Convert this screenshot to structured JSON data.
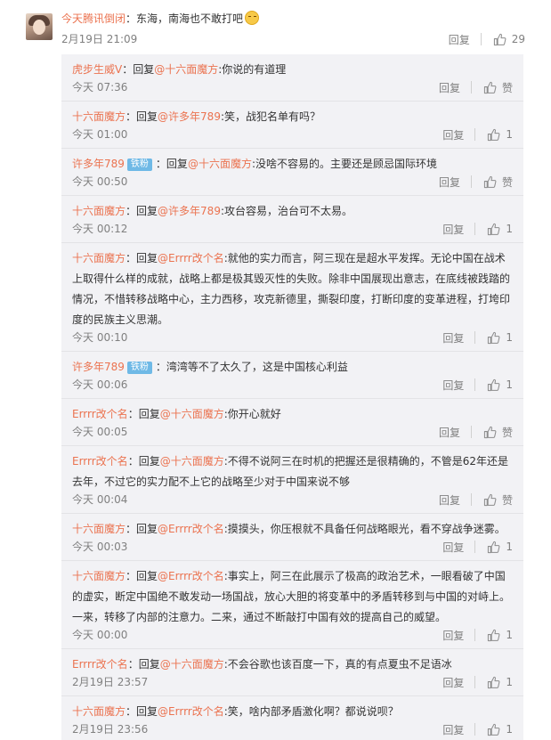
{
  "top_comment": {
    "username": "今天腾讯倒闭",
    "text": "：东海，南海也不敢打吧",
    "time": "2月19日 21:09",
    "reply_label": "回复",
    "like_count": "29",
    "emoji_icon": "thinking-face-icon"
  },
  "replies": [
    {
      "author": "虎步生威V",
      "badge": "",
      "mention": "@十六面魔方",
      "content": ":你说的有道理",
      "time": "今天 07:36",
      "reply_label": "回复",
      "likes": "赞"
    },
    {
      "author": "十六面魔方",
      "badge": "",
      "mention": "@许多年789",
      "content": ":笑，战犯名单有吗？",
      "time": "今天 01:00",
      "reply_label": "回复",
      "likes": "1"
    },
    {
      "author": "许多年789",
      "badge": "铁粉",
      "mention": "@十六面魔方",
      "content": ":没啥不容易的。主要还是顾忌国际环境",
      "time": "今天 00:50",
      "reply_label": "回复",
      "likes": "赞"
    },
    {
      "author": "十六面魔方",
      "badge": "",
      "mention": "@许多年789",
      "content": ":攻台容易，治台可不太易。",
      "time": "今天 00:12",
      "reply_label": "回复",
      "likes": "1"
    },
    {
      "author": "十六面魔方",
      "badge": "",
      "mention": "@Errrr改个名",
      "content": ":就他的实力而言，阿三现在是超水平发挥。无论中国在战术上取得什么样的成就，战略上都是极其毁灭性的失败。除非中国展现出意志，在底线被践踏的情况，不惜转移战略中心，主力西移，攻克新德里，撕裂印度，打断印度的变革进程，打垮印度的民族主义思潮。",
      "time": "今天 00:10",
      "reply_label": "回复",
      "likes": "1"
    },
    {
      "author": "许多年789",
      "badge": "铁粉",
      "mention": "",
      "content": "：湾湾等不了太久了，这是中国核心利益",
      "time": "今天 00:06",
      "reply_label": "回复",
      "likes": "1"
    },
    {
      "author": "Errrr改个名",
      "badge": "",
      "mention": "@十六面魔方",
      "content": ":你开心就好",
      "time": "今天 00:05",
      "reply_label": "回复",
      "likes": "赞"
    },
    {
      "author": "Errrr改个名",
      "badge": "",
      "mention": "@十六面魔方",
      "content": ":不得不说阿三在时机的把握还是很精确的，不管是62年还是去年，不过它的实力配不上它的战略至少对于中国来说不够",
      "time": "今天 00:04",
      "reply_label": "回复",
      "likes": "赞"
    },
    {
      "author": "十六面魔方",
      "badge": "",
      "mention": "@Errrr改个名",
      "content": ":摸摸头，你压根就不具备任何战略眼光，看不穿战争迷雾。",
      "time": "今天 00:03",
      "reply_label": "回复",
      "likes": "1"
    },
    {
      "author": "十六面魔方",
      "badge": "",
      "mention": "@Errrr改个名",
      "content": ":事实上，阿三在此展示了极高的政治艺术，一眼看破了中国的虚实，断定中国绝不敢发动一场国战，放心大胆的将变革中的矛盾转移到与中国的对峙上。一来，转移了内部的注意力。二来，通过不断敲打中国有效的提高自己的威望。",
      "time": "今天 00:00",
      "reply_label": "回复",
      "likes": "1"
    },
    {
      "author": "Errrr改个名",
      "badge": "",
      "mention": "@十六面魔方",
      "content": ":不会谷歌也该百度一下，真的有点夏虫不足语冰",
      "time": "2月19日 23:57",
      "reply_label": "回复",
      "likes": "1"
    },
    {
      "author": "十六面魔方",
      "badge": "",
      "mention": "@Errrr改个名",
      "content": ":笑，啥内部矛盾激化啊？都说说呗？",
      "time": "2月19日 23:56",
      "reply_label": "回复",
      "likes": "1"
    }
  ],
  "labels": {
    "colon": "：",
    "reply_word": "回复"
  },
  "colors": {
    "link": "#eb7350",
    "muted": "#808080",
    "reply_bg": "#f2f2f5",
    "badge": "#6fb9e6"
  },
  "icons": {
    "like": "thumbs-up-icon"
  }
}
